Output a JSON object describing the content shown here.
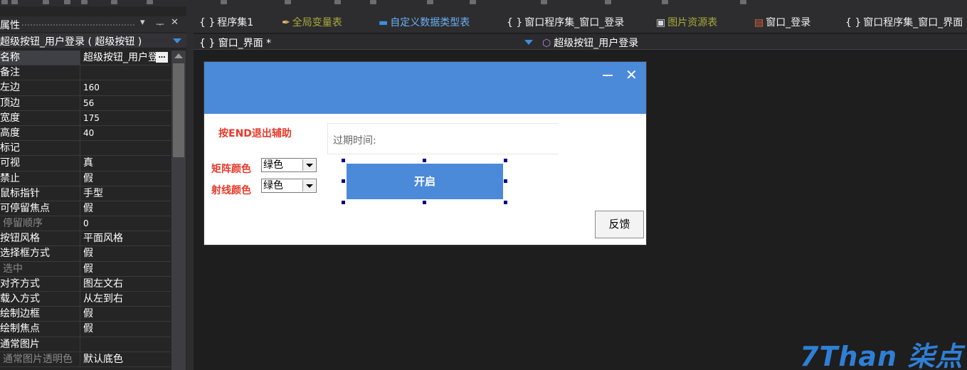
{
  "panel": {
    "title": "属性",
    "pin_btn": "ᅮ",
    "close_btn": "✕",
    "dropdown_btn": "▾",
    "selected_object": "超级按钮_用户登录 ( 超级按钮 )"
  },
  "properties": [
    {
      "name": "名称",
      "value": "超级按钮_用户登"
    },
    {
      "name": "备注",
      "value": ""
    },
    {
      "name": "左边",
      "value": "160"
    },
    {
      "name": "顶边",
      "value": "56"
    },
    {
      "name": "宽度",
      "value": "175"
    },
    {
      "name": "高度",
      "value": "40"
    },
    {
      "name": "标记",
      "value": ""
    },
    {
      "name": "可视",
      "value": "真"
    },
    {
      "name": "禁止",
      "value": "假"
    },
    {
      "name": "鼠标指针",
      "value": "手型"
    },
    {
      "name": "可停留焦点",
      "value": "假"
    },
    {
      "name": "停留顺序",
      "value": "0"
    },
    {
      "name": "按钮风格",
      "value": "平面风格"
    },
    {
      "name": "选择框方式",
      "value": "假"
    },
    {
      "name": "选中",
      "value": "假"
    },
    {
      "name": "对齐方式",
      "value": "图左文右"
    },
    {
      "name": "载入方式",
      "value": "从左到右"
    },
    {
      "name": "绘制边框",
      "value": "假"
    },
    {
      "name": "绘制焦点",
      "value": "假"
    },
    {
      "name": "通常图片",
      "value": ""
    },
    {
      "name": "通常图片透明色",
      "value": "默认底色"
    }
  ],
  "tabs": [
    {
      "icon": "{ }",
      "label": "程序集1"
    },
    {
      "icon": "✒",
      "label": "全局变量表"
    },
    {
      "icon": "▬",
      "label": "自定义数据类型表"
    },
    {
      "icon": "{ }",
      "label": "窗口程序集_窗口_登录"
    },
    {
      "icon": "▣",
      "label": "图片资源表"
    },
    {
      "icon": "▤",
      "label": "窗口_登录"
    },
    {
      "icon": "{ }",
      "label": "窗口程序集_窗口_界面"
    }
  ],
  "nav": {
    "left": "{ } 窗口_界面 *",
    "right": "超级按钮_用户登录"
  },
  "form": {
    "minimize": "",
    "close": "✕",
    "exit_hint": "按END退出辅助",
    "expire_label": "过期时间:",
    "matrix_color_label": "矩阵颜色",
    "matrix_color_value": "绿色",
    "ray_color_label": "射线颜色",
    "ray_color_value": "绿色",
    "start_button": "开启",
    "feedback_button": "反馈"
  },
  "watermark": "7Than 柒点",
  "colors": {
    "accent": "#4a8ad8",
    "hint_red": "#e53a2a",
    "dark_bg": "#1e1e1e"
  }
}
